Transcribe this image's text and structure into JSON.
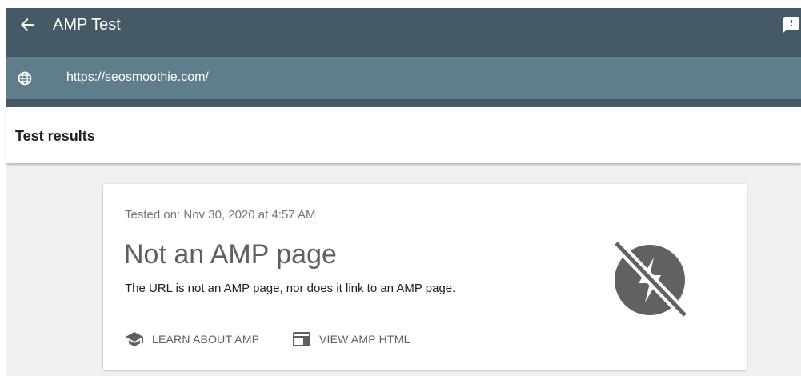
{
  "app_bar": {
    "title": "AMP Test",
    "back_icon": "arrow-back-icon",
    "feedback_icon": "feedback-icon"
  },
  "url_bar": {
    "icon": "globe-icon",
    "url": "https://seosmoothie.com/"
  },
  "results": {
    "header": "Test results"
  },
  "card": {
    "tested_on": "Tested on: Nov 30, 2020 at 4:57 AM",
    "status_title": "Not an AMP page",
    "status_description": "The URL is not an AMP page, nor does it link to an AMP page.",
    "actions": [
      {
        "label": "LEARN ABOUT AMP",
        "icon": "school-icon"
      },
      {
        "label": "VIEW AMP HTML",
        "icon": "web-page-icon"
      }
    ],
    "status_icon": "not-amp-icon"
  },
  "colors": {
    "app_bar": "#455a64",
    "url_bar": "#607d8b",
    "content_background": "#f1f1f1",
    "status_icon": "#616161"
  }
}
